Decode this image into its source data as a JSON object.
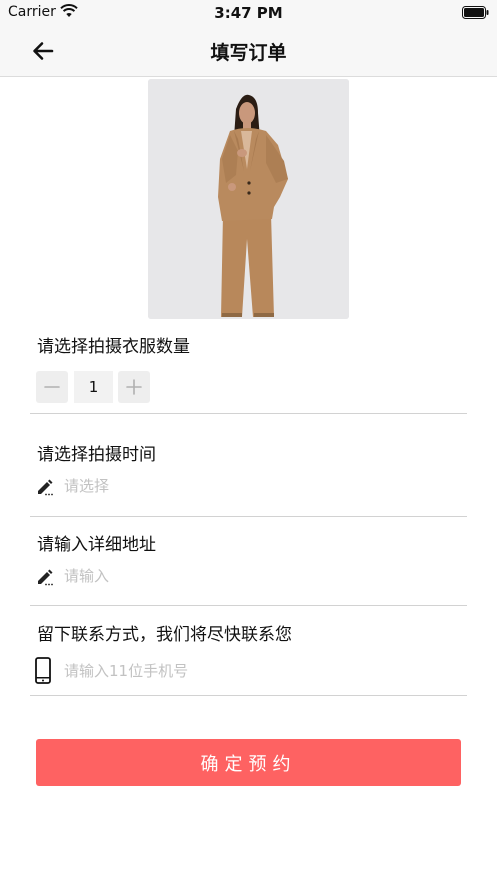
{
  "status_bar": {
    "carrier": "Carrier",
    "time": "3:47 PM"
  },
  "nav": {
    "title": "填写订单"
  },
  "quantity": {
    "title": "请选择拍摄衣服数量",
    "value": "1"
  },
  "shoot_time": {
    "title": "请选择拍摄时间",
    "placeholder": "请选择"
  },
  "address": {
    "title": "请输入详细地址",
    "placeholder": "请输入"
  },
  "contact": {
    "title": "留下联系方式，我们将尽快联系您",
    "placeholder": "请输入11位手机号"
  },
  "confirm": {
    "label": "确定预约"
  },
  "colors": {
    "accent": "#fe6262",
    "divider": "#d2d2d2",
    "placeholder": "#c2c2c2"
  }
}
